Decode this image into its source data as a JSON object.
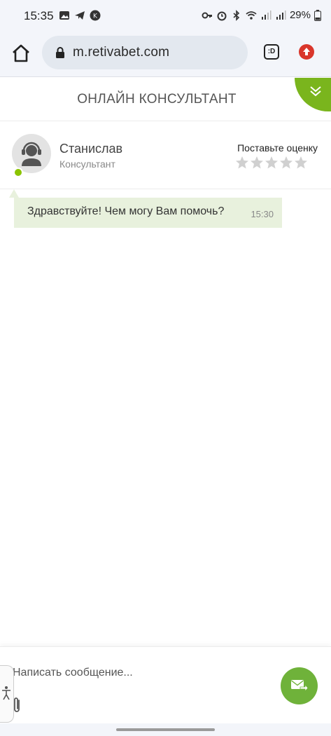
{
  "status_bar": {
    "time": "15:35",
    "battery": "29%",
    "left_icons": [
      "image-icon",
      "telegram-icon",
      "app-badge-icon"
    ],
    "right_icons": [
      "key-icon",
      "alarm-icon",
      "bluetooth-icon",
      "wifi-icon",
      "signal-icon",
      "signal-icon",
      "battery-icon"
    ]
  },
  "browser": {
    "url": "m.retivabet.com",
    "tab_label": ":D"
  },
  "chat": {
    "title": "ОНЛАЙН КОНСУЛЬТАНТ",
    "accent_color": "#7ab51d"
  },
  "consultant": {
    "name": "Станислав",
    "role": "Консультант",
    "status": "online",
    "rating_label": "Поставьте оценку",
    "rating_max": 5,
    "rating_value": 0
  },
  "messages": [
    {
      "text": "Здравствуйте! Чем могу Вам помочь?",
      "time": "15:30",
      "bubble_color": "#e8f1dd"
    }
  ],
  "composer": {
    "placeholder": "Написать сообщение...",
    "value": "",
    "send_color": "#6fb23a"
  }
}
